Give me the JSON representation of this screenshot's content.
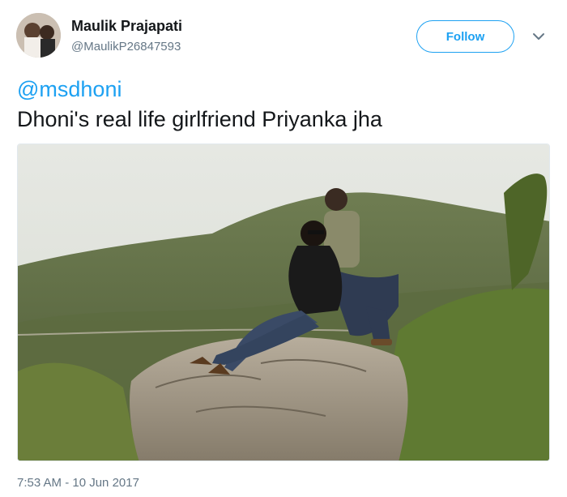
{
  "user": {
    "name": "Maulik Prajapati",
    "handle": "@MaulikP26847593"
  },
  "follow": {
    "label": "Follow"
  },
  "tweet": {
    "mention": "@msdhoni",
    "text": "Dhoni's real life girlfriend Priyanka jha"
  },
  "photo": {
    "subject": "couple-on-hilltop-rock"
  },
  "timestamp": "7:53 AM - 10 Jun 2017",
  "colors": {
    "accent": "#1da1f2",
    "text": "#14171a",
    "secondary": "#657786"
  }
}
